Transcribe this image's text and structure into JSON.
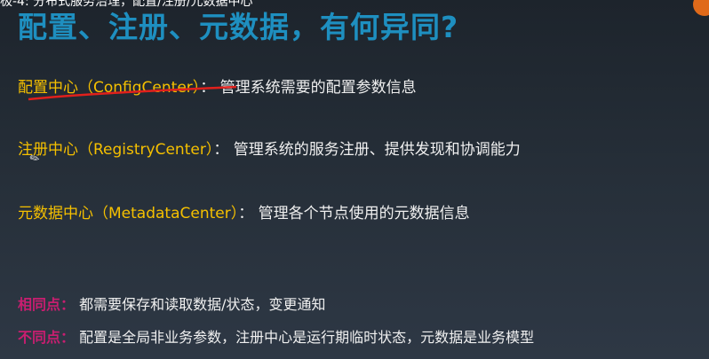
{
  "top_caption": "极-4: 分布式服务治理，配置/注册/元数据中心",
  "title": "配置、注册、元数据，有何异同?",
  "items": [
    {
      "key": "配置中心（ConfigCenter）",
      "sep": "：",
      "desc": "管理系统需要的配置参数信息"
    },
    {
      "key": "注册中心（RegistryCenter）",
      "sep": "：",
      "desc": "管理系统的服务注册、提供发现和协调能力"
    },
    {
      "key": "元数据中心（MetadataCenter）",
      "sep": "：",
      "desc": "管理各个节点使用的元数据信息"
    }
  ],
  "comparison": [
    {
      "label": "相同点：",
      "text": "都需要保存和读取数据/状态，变更通知"
    },
    {
      "label": "不同点：",
      "text": "配置是全局非业务参数，注册中心是运行期临时状态，元数据是业务模型"
    }
  ],
  "colors": {
    "title": "#1e8fc0",
    "key": "#f5c000",
    "label": "#c81e70",
    "annotation": "#e0201c"
  }
}
